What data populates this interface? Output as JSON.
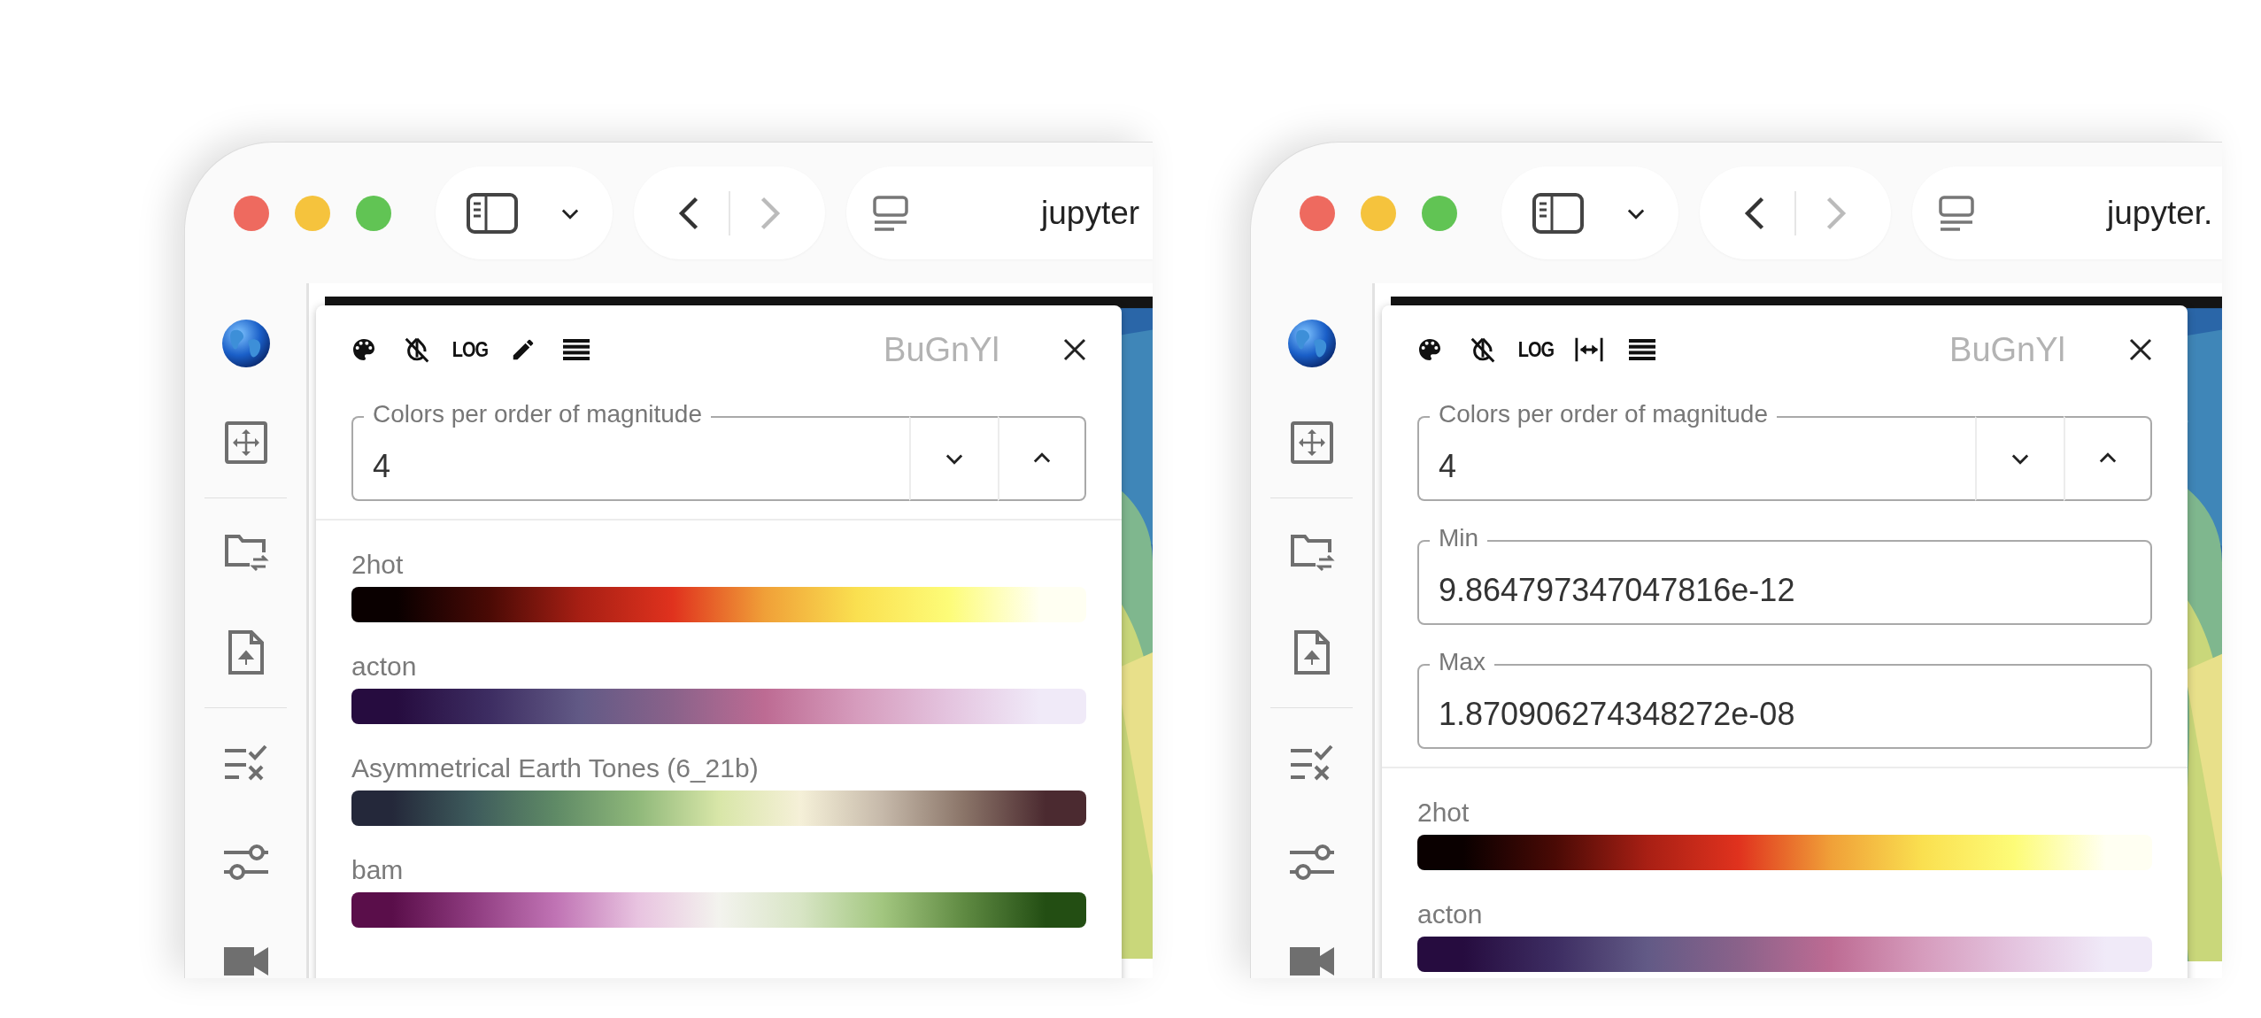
{
  "windows": [
    {
      "toolbar": {
        "back": {
          "disabled": false
        },
        "forward": {
          "disabled": true
        },
        "address": "jupyter"
      },
      "sidebar": {
        "groups": [
          [
            {
              "kind": "globe"
            },
            {
              "kind": "move"
            }
          ],
          [
            {
              "kind": "folder-swap"
            },
            {
              "kind": "file-upload"
            }
          ],
          [
            {
              "kind": "checklist"
            },
            {
              "kind": "sliders"
            },
            {
              "kind": "video"
            }
          ]
        ]
      },
      "panel": {
        "tools": [
          {
            "kind": "palette"
          },
          {
            "kind": "invert-off"
          },
          {
            "kind": "log",
            "label": "LOG"
          },
          {
            "kind": "pencil"
          },
          {
            "kind": "lines"
          }
        ],
        "colormap_name": "BuGnYl",
        "fields": [
          {
            "kind": "number",
            "label": "Colors per order of magnitude",
            "value": "4"
          }
        ],
        "colormaps": [
          {
            "name": "2hot",
            "stops": [
              {
                "color": "#0a0000"
              },
              {
                "color": "#4a0a05"
              },
              {
                "color": "#a81f14"
              },
              {
                "color": "#e0321e"
              },
              {
                "color": "#f0a038"
              },
              {
                "color": "#fae050"
              },
              {
                "color": "#fdfc78"
              },
              {
                "color": "#fffff2"
              }
            ]
          },
          {
            "name": "acton",
            "stops": [
              {
                "color": "#260c3f"
              },
              {
                "color": "#3d2d62"
              },
              {
                "color": "#625a86"
              },
              {
                "color": "#8a628a"
              },
              {
                "color": "#bd6b93"
              },
              {
                "color": "#d69cbd"
              },
              {
                "color": "#e4c4df"
              },
              {
                "color": "#f0eaf8"
              }
            ]
          },
          {
            "name": "Asymmetrical Earth Tones (6_21b)",
            "stops": [
              {
                "color": "#24283a"
              },
              {
                "color": "#3e5b5c"
              },
              {
                "color": "#5f8a66"
              },
              {
                "color": "#8fb87a"
              },
              {
                "color": "#d8e6a8"
              },
              {
                "color": "#f5f0d8"
              },
              {
                "color": "#c6b9aa"
              },
              {
                "color": "#8a7468"
              },
              {
                "color": "#4b2a30"
              }
            ]
          },
          {
            "name": "bam",
            "stops": [
              {
                "color": "#5a0e4a"
              },
              {
                "color": "#8f3c80"
              },
              {
                "color": "#c073b4"
              },
              {
                "color": "#e8c3e0"
              },
              {
                "color": "#f3f3ee"
              },
              {
                "color": "#d8e5c5"
              },
              {
                "color": "#a2c67f"
              },
              {
                "color": "#5f8a42"
              },
              {
                "color": "#234e13"
              }
            ]
          }
        ]
      }
    },
    {
      "toolbar": {
        "back": {
          "disabled": false
        },
        "forward": {
          "disabled": true
        },
        "address": "jupyter."
      },
      "sidebar": {
        "groups": [
          [
            {
              "kind": "globe"
            },
            {
              "kind": "move"
            }
          ],
          [
            {
              "kind": "folder-swap"
            },
            {
              "kind": "file-upload"
            }
          ],
          [
            {
              "kind": "checklist"
            },
            {
              "kind": "sliders"
            },
            {
              "kind": "video"
            }
          ]
        ]
      },
      "panel": {
        "tools": [
          {
            "kind": "palette"
          },
          {
            "kind": "invert-off"
          },
          {
            "kind": "log",
            "label": "LOG"
          },
          {
            "kind": "width"
          },
          {
            "kind": "lines"
          }
        ],
        "colormap_name": "BuGnYl",
        "fields": [
          {
            "kind": "number",
            "label": "Colors per order of magnitude",
            "value": "4"
          },
          {
            "kind": "text",
            "label": "Min",
            "value": "9.864797347047816e-12"
          },
          {
            "kind": "text",
            "label": "Max",
            "value": "1.870906274348272e-08"
          }
        ],
        "colormaps": [
          {
            "name": "2hot",
            "stops": [
              {
                "color": "#0a0000"
              },
              {
                "color": "#4a0a05"
              },
              {
                "color": "#a81f14"
              },
              {
                "color": "#e0321e"
              },
              {
                "color": "#f0a038"
              },
              {
                "color": "#fae050"
              },
              {
                "color": "#fdfc78"
              },
              {
                "color": "#fffff2"
              }
            ]
          },
          {
            "name": "acton",
            "stops": [
              {
                "color": "#260c3f"
              },
              {
                "color": "#3d2d62"
              },
              {
                "color": "#625a86"
              },
              {
                "color": "#8a628a"
              },
              {
                "color": "#bd6b93"
              },
              {
                "color": "#d69cbd"
              },
              {
                "color": "#e4c4df"
              },
              {
                "color": "#f0eaf8"
              }
            ]
          }
        ]
      }
    }
  ]
}
